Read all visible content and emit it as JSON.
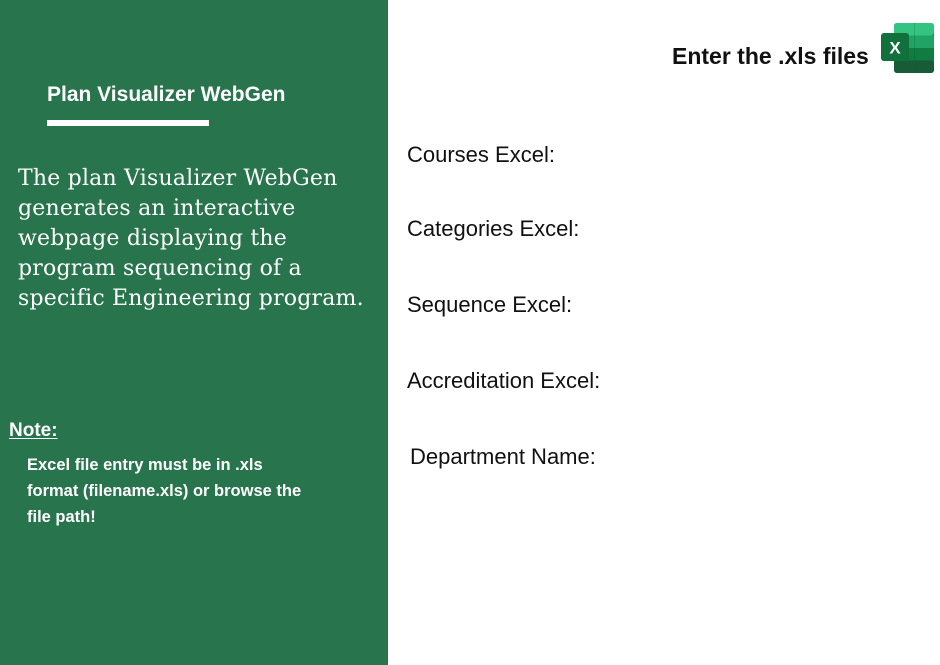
{
  "sidebar": {
    "title": "Plan Visualizer WebGen",
    "description": "The plan Visualizer WebGen generates an interactive webpage displaying the program sequencing of a specific Engineering program.",
    "note_label": "Note:",
    "note_text": "Excel file entry must be in .xls format (filename.xls) or browse the file path!"
  },
  "header": {
    "title": "Enter the .xls files",
    "icon": "excel-icon",
    "icon_letter": "X"
  },
  "form": {
    "courses_label": "Courses Excel:",
    "courses_value": "",
    "categories_label": "Categories Excel:",
    "categories_value": "",
    "sequence_label": "Sequence Excel:",
    "sequence_value": "",
    "accreditation_label": "Accreditation Excel:",
    "accreditation_value": "",
    "department_label": "Department Name:",
    "department_value": ""
  },
  "colors": {
    "sidebar_bg": "#28744c",
    "excel_dark": "#185c37",
    "excel_mid": "#21a366",
    "excel_light": "#33c481",
    "excel_base": "#107c41"
  }
}
